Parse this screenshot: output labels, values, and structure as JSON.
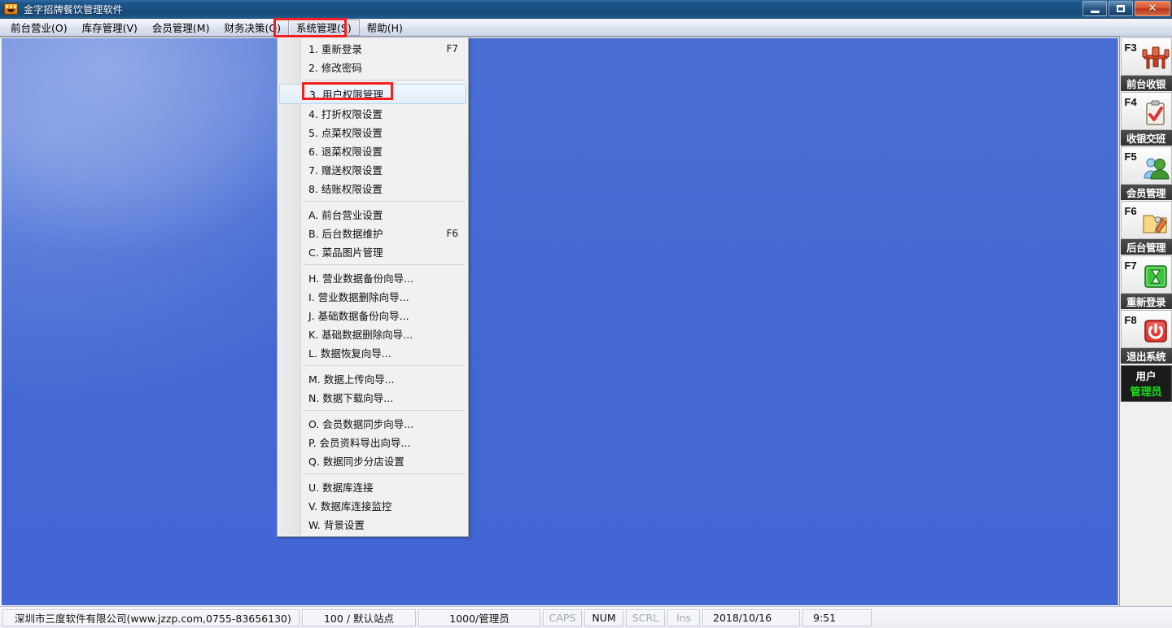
{
  "window": {
    "title": "金字招牌餐饮管理软件",
    "app_icon": "restaurant-app-icon",
    "buttons": {
      "minimize": "minimize-icon",
      "maximize": "maximize-icon",
      "close": "✕"
    }
  },
  "menubar": {
    "items": [
      {
        "label": "前台营业(O)",
        "open": false
      },
      {
        "label": "库存管理(V)",
        "open": false
      },
      {
        "label": "会员管理(M)",
        "open": false
      },
      {
        "label": "财务决策(Q)",
        "open": false
      },
      {
        "label": "系统管理(S)",
        "open": true
      },
      {
        "label": "帮助(H)",
        "open": false
      }
    ]
  },
  "dropdown": {
    "owner": "系统管理(S)",
    "groups": [
      {
        "items": [
          {
            "label": "1. 重新登录",
            "accel": "F7",
            "selected": false
          },
          {
            "label": "2. 修改密码",
            "accel": "",
            "selected": false
          }
        ]
      },
      {
        "items": [
          {
            "label": "3. 用户权限管理",
            "accel": "",
            "selected": true
          },
          {
            "label": "4. 打折权限设置",
            "accel": "",
            "selected": false
          },
          {
            "label": "5. 点菜权限设置",
            "accel": "",
            "selected": false
          },
          {
            "label": "6. 退菜权限设置",
            "accel": "",
            "selected": false
          },
          {
            "label": "7. 赠送权限设置",
            "accel": "",
            "selected": false
          },
          {
            "label": "8. 结账权限设置",
            "accel": "",
            "selected": false
          }
        ]
      },
      {
        "items": [
          {
            "label": "A. 前台营业设置",
            "accel": "",
            "selected": false
          },
          {
            "label": "B. 后台数据维护",
            "accel": "F6",
            "selected": false
          },
          {
            "label": "C. 菜品图片管理",
            "accel": "",
            "selected": false
          }
        ]
      },
      {
        "items": [
          {
            "label": "H. 营业数据备份向导...",
            "accel": "",
            "selected": false
          },
          {
            "label": "I. 营业数据删除向导...",
            "accel": "",
            "selected": false
          },
          {
            "label": "J. 基础数据备份向导...",
            "accel": "",
            "selected": false
          },
          {
            "label": "K. 基础数据删除向导...",
            "accel": "",
            "selected": false
          },
          {
            "label": "L. 数据恢复向导...",
            "accel": "",
            "selected": false
          }
        ]
      },
      {
        "items": [
          {
            "label": "M. 数据上传向导...",
            "accel": "",
            "selected": false
          },
          {
            "label": "N. 数据下载向导...",
            "accel": "",
            "selected": false
          }
        ]
      },
      {
        "items": [
          {
            "label": "O. 会员数据同步向导...",
            "accel": "",
            "selected": false
          },
          {
            "label": "P. 会员资料导出向导...",
            "accel": "",
            "selected": false
          },
          {
            "label": "Q. 数据同步分店设置",
            "accel": "",
            "selected": false
          }
        ]
      },
      {
        "items": [
          {
            "label": "U. 数据库连接",
            "accel": "",
            "selected": false
          },
          {
            "label": "V. 数据库连接监控",
            "accel": "",
            "selected": false
          },
          {
            "label": "W. 背景设置",
            "accel": "",
            "selected": false
          }
        ]
      }
    ]
  },
  "sidebar": {
    "buttons": [
      {
        "key": "F3",
        "caption": "前台收银",
        "icon": "table-chairs-icon"
      },
      {
        "key": "F4",
        "caption": "收银交班",
        "icon": "clipboard-check-icon"
      },
      {
        "key": "F5",
        "caption": "会员管理",
        "icon": "people-icon"
      },
      {
        "key": "F6",
        "caption": "后台管理",
        "icon": "folder-tools-icon"
      },
      {
        "key": "F7",
        "caption": "重新登录",
        "icon": "green-hourglass-icon"
      },
      {
        "key": "F8",
        "caption": "退出系统",
        "icon": "red-power-icon"
      }
    ],
    "user_panel": {
      "title": "用户",
      "name": "管理员",
      "name_color": "#14e614"
    }
  },
  "statusbar": {
    "company": "深圳市三度软件有限公司(www.jzzp.com,0755-83656130)",
    "site": "100 / 默认站点",
    "user": "1000/管理员",
    "caps": "CAPS",
    "num": "NUM",
    "scrl": "SCRL",
    "ins": "Ins",
    "date": "2018/10/16",
    "time": "9:51"
  },
  "annotations": {
    "menu_highlight": "系统管理(S)",
    "item_highlight": "3. 用户权限管理",
    "color": "#f41f1f"
  }
}
